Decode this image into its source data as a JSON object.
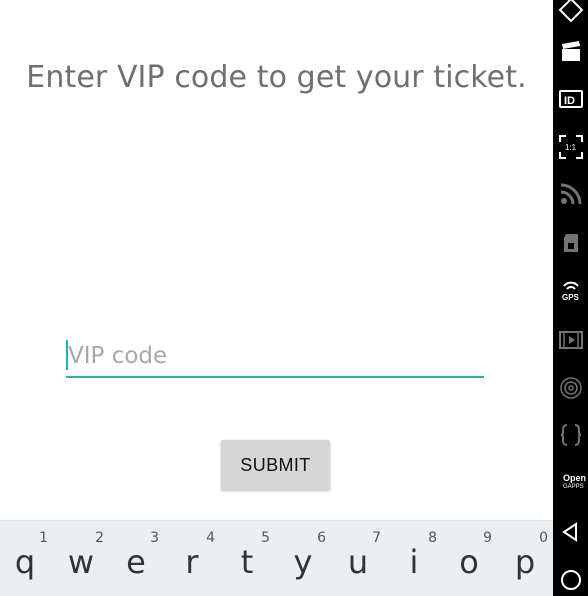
{
  "screen": {
    "prompt": "Enter VIP code to get your ticket.",
    "input": {
      "placeholder": "VIP code",
      "value": ""
    },
    "submit_label": "SUBMIT"
  },
  "keyboard": {
    "keys": [
      {
        "letter": "q",
        "hint": "1"
      },
      {
        "letter": "w",
        "hint": "2"
      },
      {
        "letter": "e",
        "hint": "3"
      },
      {
        "letter": "r",
        "hint": "4"
      },
      {
        "letter": "t",
        "hint": "5"
      },
      {
        "letter": "y",
        "hint": "6"
      },
      {
        "letter": "u",
        "hint": "7"
      },
      {
        "letter": "i",
        "hint": "8"
      },
      {
        "letter": "o",
        "hint": "9"
      },
      {
        "letter": "p",
        "hint": "0"
      }
    ]
  },
  "side_bar": {
    "icons": [
      "tag-icon",
      "clapperboard-icon",
      "id-card-icon",
      "aspect-ratio-icon",
      "rss-feed-icon",
      "sim-card-icon",
      "gps-icon",
      "video-frames-icon",
      "fingerprint-icon",
      "code-braces-icon",
      "opengapps-icon",
      "back-icon",
      "home-icon"
    ],
    "id_label": "ID",
    "ratio_label": "1:1",
    "gps_label": "GPS",
    "opengapps_label": "Open",
    "opengapps_sub": "GAPPS"
  },
  "colors": {
    "accent": "#1fb7a6",
    "button_bg": "#d6d6d6",
    "keyboard_bg": "#eceff1",
    "nav_bg": "#000000"
  }
}
